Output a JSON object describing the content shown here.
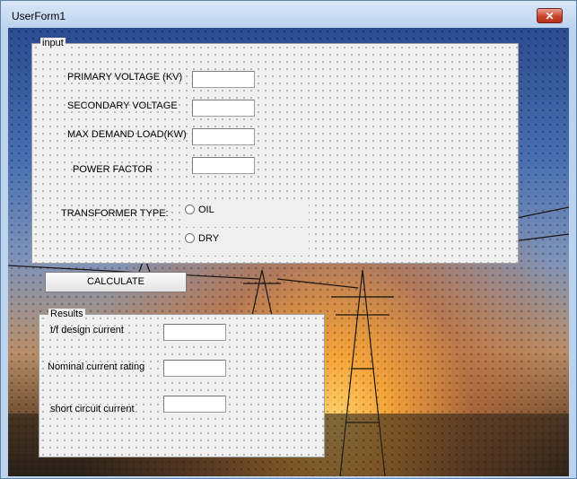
{
  "window": {
    "title": "UserForm1",
    "close_glyph": "✕"
  },
  "input_frame": {
    "caption": "input",
    "primary_voltage_label": "PRIMARY VOLTAGE (KV)",
    "secondary_voltage_label": "SECONDARY VOLTAGE",
    "max_demand_label": "MAX DEMAND LOAD(KW)",
    "power_factor_label": "POWER FACTOR",
    "transformer_type_label": "TRANSFORMER TYPE:",
    "option_oil": "OIL",
    "option_dry": "DRY",
    "primary_voltage_value": "",
    "secondary_voltage_value": "",
    "max_demand_value": "",
    "power_factor_value": ""
  },
  "calculate_label": "CALCULATE",
  "results_frame": {
    "caption": "Results",
    "design_current_label": "t/f design current",
    "nominal_current_label": "Nominal current rating",
    "short_circuit_label": "short circuit current",
    "design_current_value": "",
    "nominal_current_value": "",
    "short_circuit_value": ""
  },
  "icons": {
    "close": "close-icon"
  }
}
